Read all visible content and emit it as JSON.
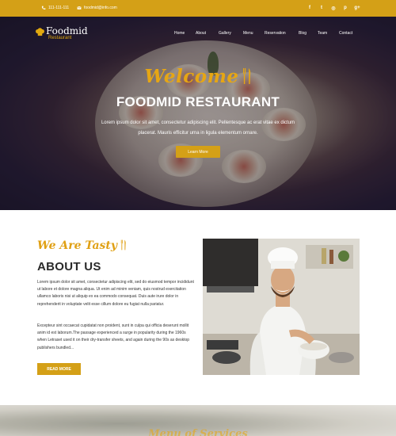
{
  "topbar": {
    "phone": "111-111-111",
    "email": "foodmid@info.com",
    "social_icons": [
      "facebook-icon",
      "twitter-icon",
      "instagram-icon",
      "pinterest-icon",
      "google-plus-icon"
    ],
    "social_glyphs": [
      "f",
      "t",
      "◎",
      "p",
      "g+"
    ]
  },
  "brand": {
    "name": "Foodmid",
    "sub": "Restaurant"
  },
  "nav": {
    "items": [
      "Home",
      "About",
      "Gallery",
      "Menu",
      "Reservation",
      "Blog",
      "Team",
      "Contact"
    ]
  },
  "hero": {
    "script_title": "Welcome",
    "title": "FOODMID RESTAURANT",
    "text": "Lorem ipsum dolor sit amet, consectetur adipiscing elit. Pellentesque ac erat vitae ex dictum placerat. Mauris efficitur urna in ligula elementum ornare.",
    "button": "Learn More"
  },
  "about": {
    "script_title": "We Are Tasty",
    "title": "ABOUT US",
    "para1": "Lorem ipsum dolor sit amet, consectetur adipiscing elit, sed do eiusmod tempor incididunt ut labore et dolore magna aliqua. Ut enim ad minim veniam, quis nostrud exercitation ullamco laboris nisi ut aliquip ex ea commodo consequat. Duis aute irure dolor in reprehenderit in voluptate velit esse cillum dolore eu fugiat nulla pariatur.",
    "para2": "Excepteur sint occaecat cupidatat non proident, sunt in culpa qui officia deserunt mollit anim id est laborum.The passage experienced a surge in popularity during the 1960s when Letraset used it on their dry-transfer sheets, and again during the 90s as desktop publishers bundled...",
    "button": "READ MORE"
  },
  "next_section": {
    "script_title": "Menu of Services"
  },
  "colors": {
    "accent": "#d4a017",
    "dark_text": "#2a2a2a"
  }
}
